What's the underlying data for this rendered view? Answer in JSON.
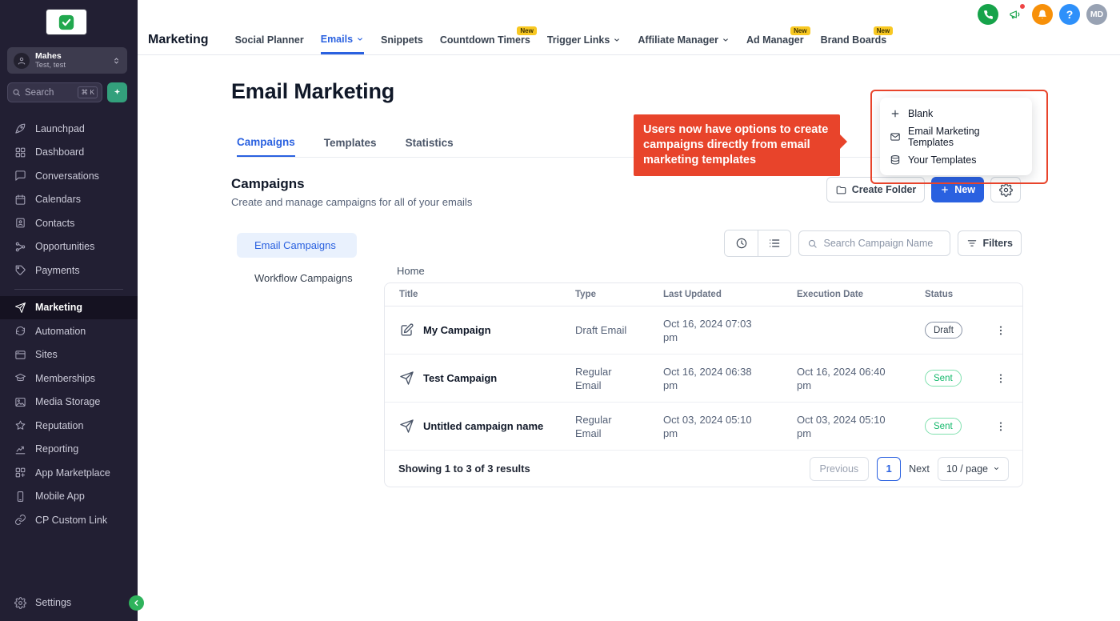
{
  "colors": {
    "accent_blue": "#2A61E0",
    "annotation_red": "#E8442B",
    "sent_green": "#12B76A",
    "draft_gray": "#384250",
    "badge_yellow": "#F8C822",
    "sidebar_bg": "#221F33"
  },
  "icons": {
    "sidebar": [
      "rocket",
      "grid",
      "chat-bubble",
      "calendar",
      "id-card",
      "share-nodes",
      "tag",
      "send",
      "refresh",
      "browser",
      "graduation-cap",
      "image",
      "star",
      "trend-up",
      "apps",
      "smartphone",
      "link",
      "gear"
    ],
    "top_right": [
      "phone",
      "megaphone",
      "bell",
      "question-mark",
      "avatar"
    ]
  },
  "sidebar": {
    "account": {
      "name": "Mahes",
      "subtitle": "Test, test"
    },
    "search": {
      "placeholder": "Search",
      "shortcut": "⌘ K"
    },
    "items": [
      {
        "label": "Launchpad"
      },
      {
        "label": "Dashboard"
      },
      {
        "label": "Conversations"
      },
      {
        "label": "Calendars"
      },
      {
        "label": "Contacts"
      },
      {
        "label": "Opportunities"
      },
      {
        "label": "Payments"
      },
      {
        "label": "Marketing"
      },
      {
        "label": "Automation"
      },
      {
        "label": "Sites"
      },
      {
        "label": "Memberships"
      },
      {
        "label": "Media Storage"
      },
      {
        "label": "Reputation"
      },
      {
        "label": "Reporting"
      },
      {
        "label": "App Marketplace"
      },
      {
        "label": "Mobile App"
      },
      {
        "label": "CP Custom Link"
      }
    ],
    "settings_label": "Settings"
  },
  "topnav": {
    "title": "Marketing",
    "tabs": [
      {
        "label": "Social Planner"
      },
      {
        "label": "Emails"
      },
      {
        "label": "Snippets"
      },
      {
        "label": "Countdown Timers",
        "badge": "New"
      },
      {
        "label": "Trigger Links"
      },
      {
        "label": "Affiliate Manager"
      },
      {
        "label": "Ad Manager",
        "badge": "New"
      },
      {
        "label": "Brand Boards",
        "badge": "New"
      }
    ],
    "help_label": "?",
    "avatar_initials": "MD"
  },
  "page": {
    "title": "Email Marketing",
    "tabs": [
      {
        "label": "Campaigns"
      },
      {
        "label": "Templates"
      },
      {
        "label": "Statistics"
      }
    ],
    "section_title": "Campaigns",
    "section_subtitle": "Create and manage campaigns for all of your emails",
    "create_folder_label": "Create Folder",
    "new_label": "New"
  },
  "annotation": {
    "text": "Users now have options to create campaigns directly from email marketing templates"
  },
  "new_menu": {
    "items": [
      {
        "label": "Blank"
      },
      {
        "label": "Email Marketing Templates"
      },
      {
        "label": "Your Templates"
      }
    ]
  },
  "campaign_nav": {
    "items": [
      {
        "label": "Email Campaigns"
      },
      {
        "label": "Workflow Campaigns"
      }
    ]
  },
  "toolbar": {
    "search_placeholder": "Search Campaign Name",
    "filters_label": "Filters"
  },
  "breadcrumb": "Home",
  "table": {
    "columns": [
      "Title",
      "Type",
      "Last Updated",
      "Execution Date",
      "Status"
    ],
    "rows": [
      {
        "title": "My Campaign",
        "type": "Draft Email",
        "last_updated": "Oct 16, 2024 07:03 pm",
        "execution_date": "",
        "status": "Draft"
      },
      {
        "title": "Test Campaign",
        "type": "Regular Email",
        "last_updated": "Oct 16, 2024 06:38 pm",
        "execution_date": "Oct 16, 2024 06:40 pm",
        "status": "Sent"
      },
      {
        "title": "Untitled campaign name",
        "type": "Regular Email",
        "last_updated": "Oct 03, 2024 05:10 pm",
        "execution_date": "Oct 03, 2024 05:10 pm",
        "status": "Sent"
      }
    ]
  },
  "pagination": {
    "summary": "Showing 1 to 3 of 3 results",
    "previous_label": "Previous",
    "current_page": "1",
    "next_label": "Next",
    "page_size": "10 / page"
  }
}
